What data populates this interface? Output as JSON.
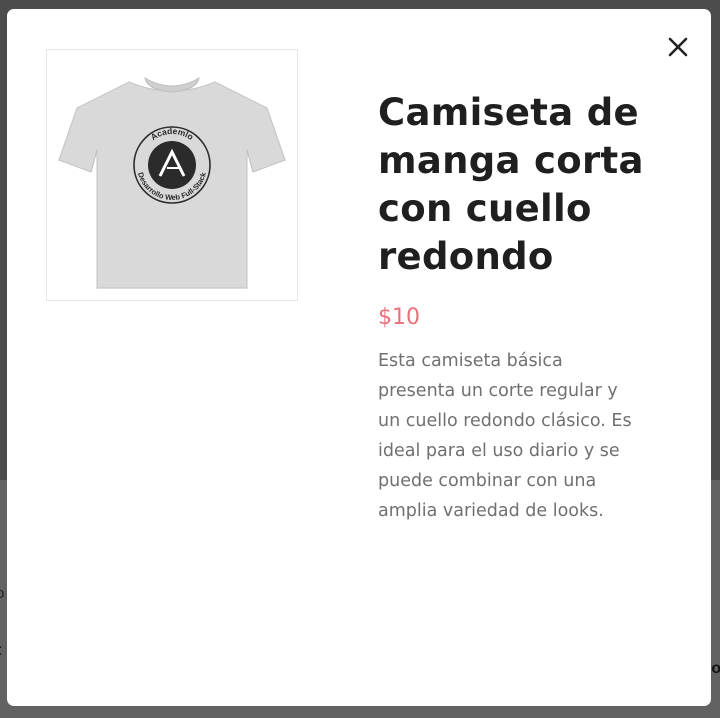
{
  "background_page": {
    "fragments": [
      "o",
      "t",
      "to"
    ]
  },
  "modal": {
    "close_icon": "close-icon",
    "product": {
      "image_icon": "tshirt-image",
      "title": "Camiseta de manga corta con cuello redondo",
      "price": "$10",
      "description": "Esta camiseta básica presenta un corte regular y un cuello redondo clásico. Es ideal para el uso diario y se puede combinar con una amplia variedad de looks.",
      "image_logo_text": {
        "top": "Academlo",
        "bottom": "Desarrollo Web Full-Stack",
        "mark": "A"
      }
    }
  },
  "colors": {
    "price": "#e9717b",
    "title": "#1f1f1f",
    "description": "#707070",
    "overlay": "#5d5d5d"
  }
}
